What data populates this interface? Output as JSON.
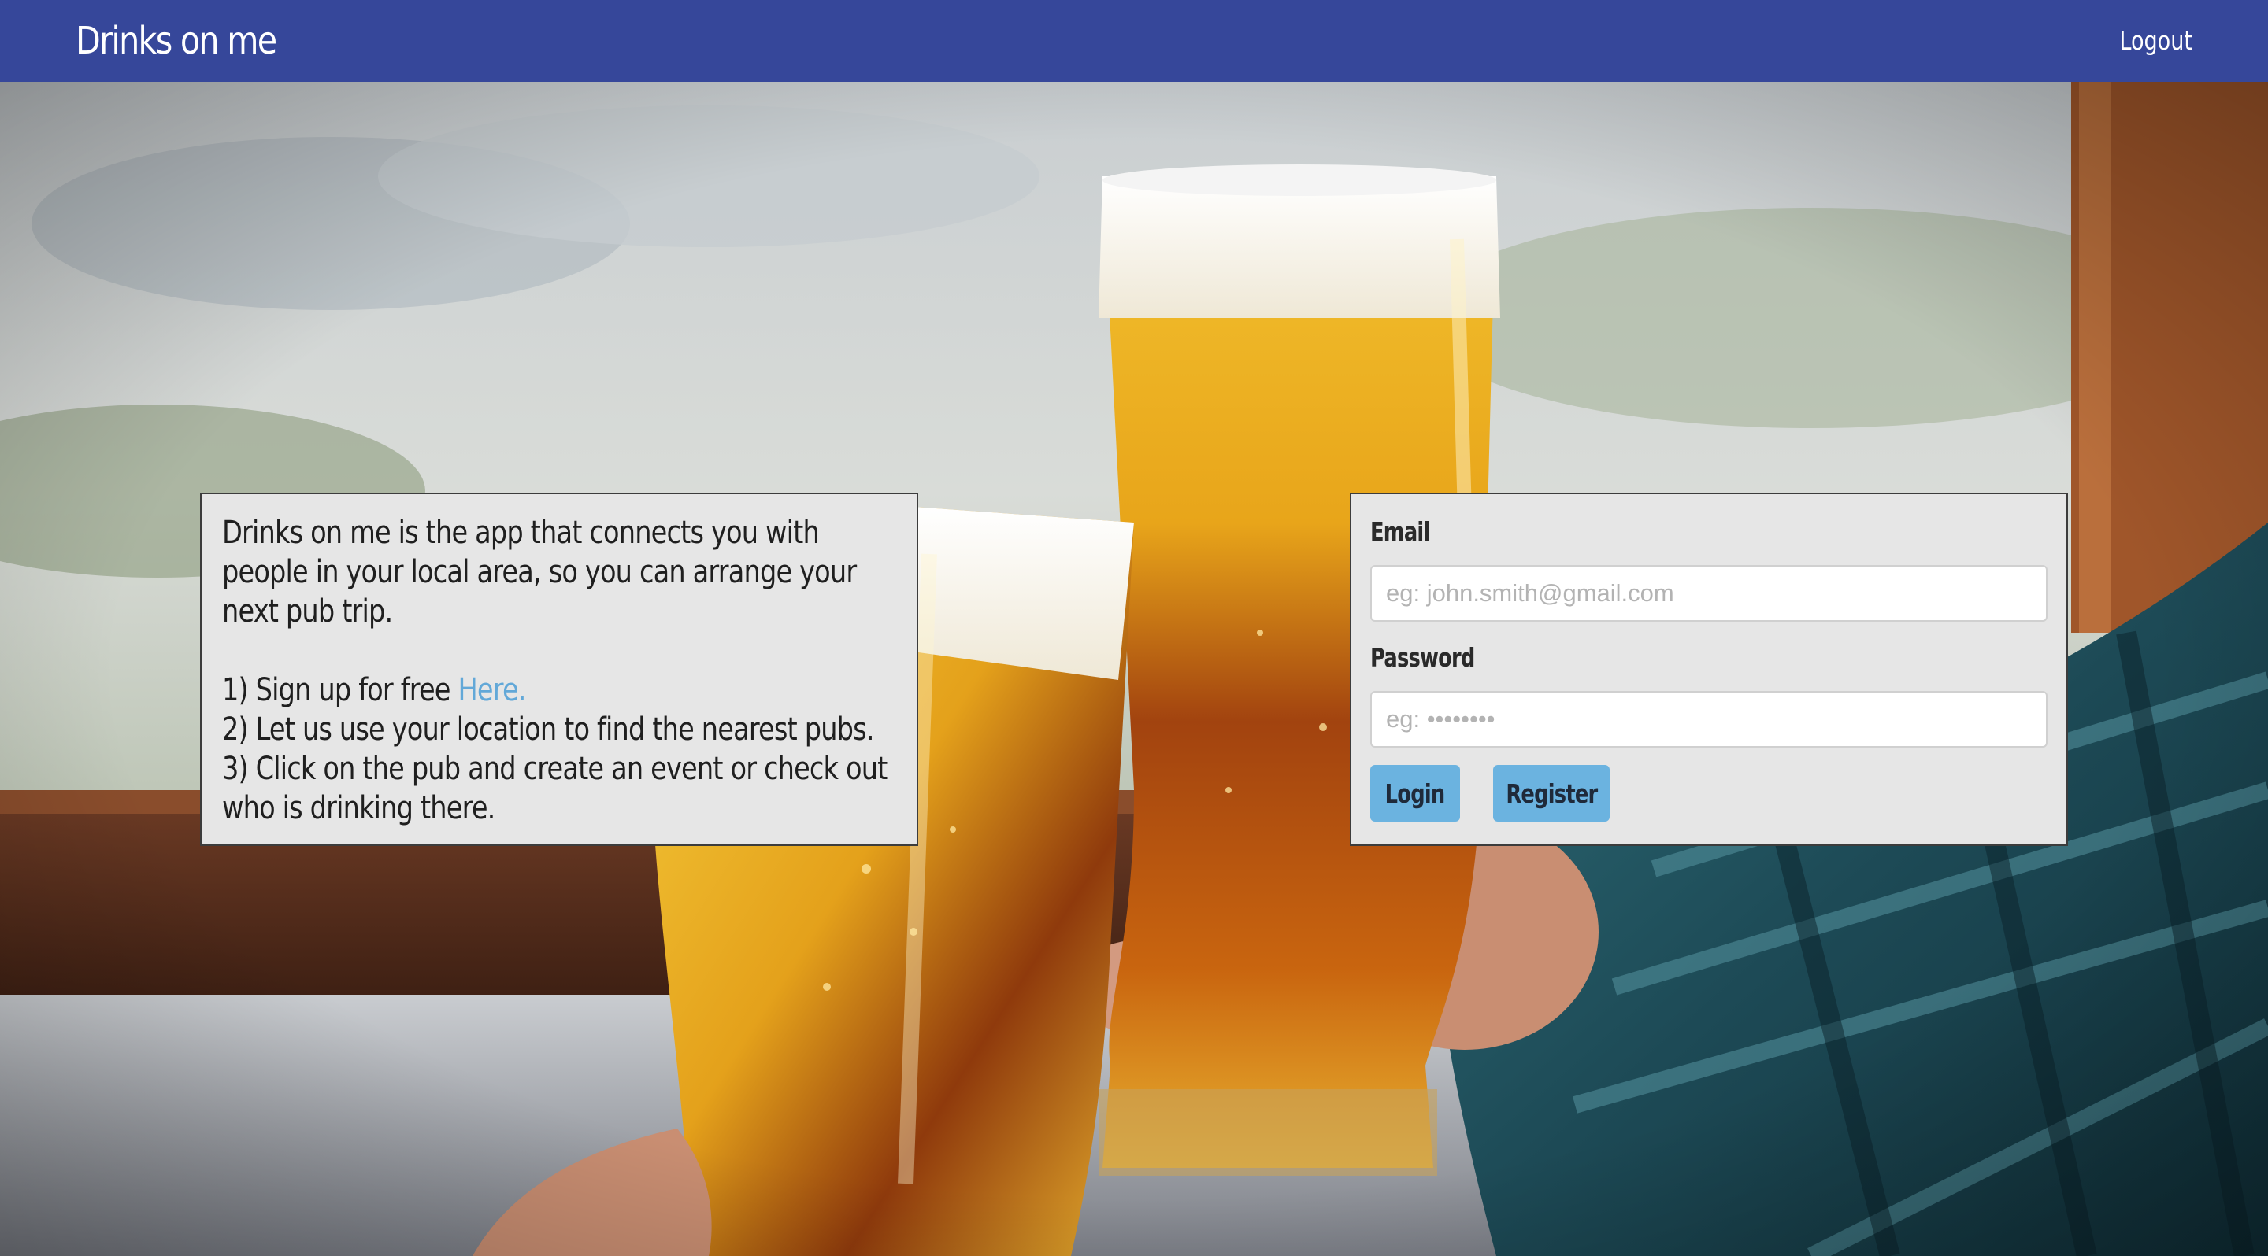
{
  "navbar": {
    "brand": "Drinks on me",
    "logout_label": "Logout",
    "background_color": "#36479a"
  },
  "info": {
    "intro": "Drinks on me is the app that connects you with people in your local area, so you can arrange your next pub trip.",
    "step1_prefix": "1) Sign up for free ",
    "step1_link": "Here.",
    "step2": "2) Let us use your location to find the nearest pubs.",
    "step3": "3) Click on the pub and create an event or check out who is drinking there."
  },
  "login_form": {
    "email_label": "Email",
    "email_placeholder": "eg: john.smith@gmail.com",
    "email_value": "",
    "password_label": "Password",
    "password_placeholder": "eg: ••••••••",
    "password_value": "",
    "login_label": "Login",
    "register_label": "Register",
    "button_color": "#6bb3e0"
  },
  "background_image": {
    "icon": "two-beer-glasses-toasting-photo"
  }
}
